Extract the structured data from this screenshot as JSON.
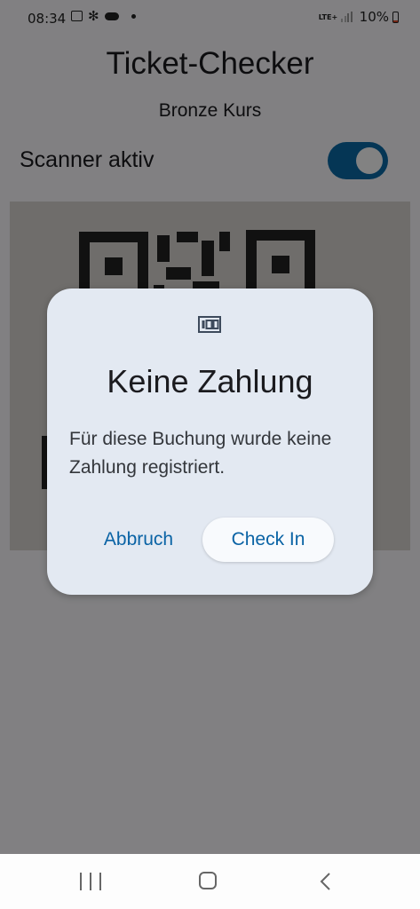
{
  "status_bar": {
    "time": "08:34",
    "network": "LTE+",
    "battery": "10%",
    "icons": [
      "image-icon",
      "fan-icon",
      "cloud-icon",
      "dot-icon",
      "signal-icon",
      "battery-icon"
    ]
  },
  "app": {
    "title": "Ticket-Checker",
    "subtitle": "Bronze Kurs",
    "scanner_label": "Scanner aktiv",
    "scanner_enabled": true
  },
  "dialog": {
    "icon": "ticket-icon",
    "title": "Keine Zahlung",
    "message": "Für diese Buchung wurde keine Zahlung registriert.",
    "cancel_label": "Abbruch",
    "confirm_label": "Check In"
  },
  "nav_bar": {
    "icons": [
      "recents-icon",
      "home-icon",
      "back-icon"
    ]
  },
  "colors": {
    "accent": "#0b6aa8",
    "dialog_background": "#e3e9f2",
    "button_text": "#0a63a5"
  }
}
